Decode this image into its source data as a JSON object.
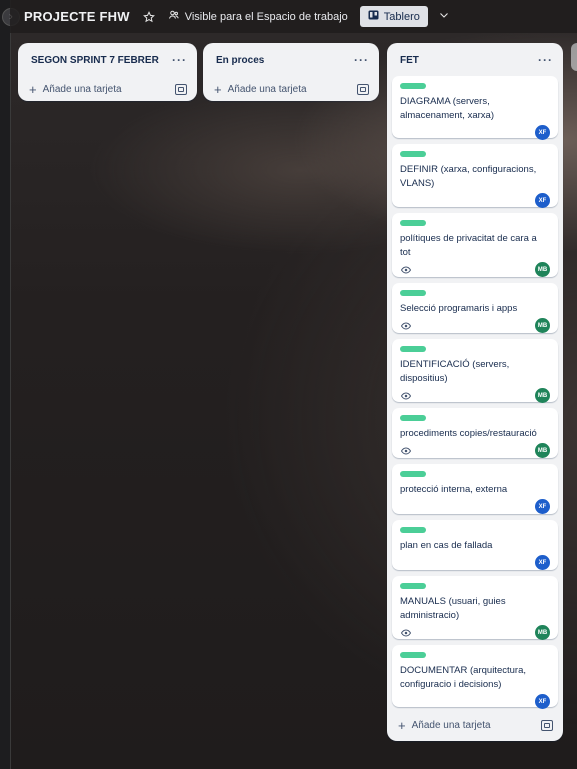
{
  "board": {
    "title": "PROJECTE FHW",
    "visibility_label": "Visible para el Espacio de trabajo",
    "view_label": "Tablero"
  },
  "lists": [
    {
      "title": "SEGON SPRINT 7 FEBRER",
      "add_card_label": "Añade una tarjeta"
    },
    {
      "title": "En proces",
      "add_card_label": "Añade una tarjeta"
    },
    {
      "title": "FET",
      "add_card_label": "Añade una tarjeta",
      "cards": [
        {
          "title": "DIAGRAMA (servers, almacenament, xarxa)",
          "watch": false,
          "member": "XF"
        },
        {
          "title": "DEFINIR (xarxa, configuracions, VLANS)",
          "watch": false,
          "member": "XF"
        },
        {
          "title": "polítiques de privacitat de cara a tot",
          "watch": true,
          "member": "MB"
        },
        {
          "title": "Selecció programaris i apps",
          "watch": true,
          "member": "MB"
        },
        {
          "title": "IDENTIFICACIÓ (servers, dispositius)",
          "watch": true,
          "member": "MB"
        },
        {
          "title": "procediments copies/restauració",
          "watch": true,
          "member": "MB"
        },
        {
          "title": "protecció interna, externa",
          "watch": false,
          "member": "XF"
        },
        {
          "title": "plan en cas de fallada",
          "watch": false,
          "member": "XF"
        },
        {
          "title": "MANUALS (usuari, guies administracio)",
          "watch": true,
          "member": "MB"
        },
        {
          "title": "DOCUMENTAR (arquitectura, configuracio i decisions)",
          "watch": false,
          "member": "XF"
        }
      ]
    }
  ],
  "icons": {
    "sidebar_toggle": "chevron-right-icon",
    "star": "star-icon",
    "visibility": "people-icon",
    "view": "board-icon",
    "view_menu": "chevron-down-icon",
    "list_menu": "more-icon",
    "add": "plus-icon",
    "template": "template-icon",
    "watch": "eye-icon"
  },
  "colors": {
    "label_green": "#4bce97",
    "avatar_xf": "#1d5ecb",
    "avatar_mb": "#1f845a",
    "list_bg": "#f1f2f4"
  }
}
